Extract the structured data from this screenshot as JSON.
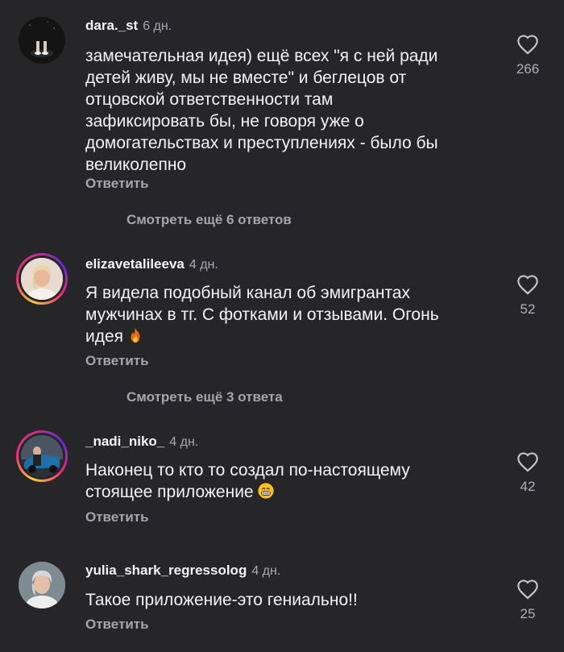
{
  "comments": [
    {
      "username": "dara._st",
      "time": "6 дн.",
      "text_lines": [
        "замечательная идея) ещё всех \"я с ней ради",
        "детей живу, мы не вместе\" и беглецов от",
        "отцовской ответственности там",
        "зафиксировать бы, не говоря уже о",
        "домогательствах и преступлениях - было бы",
        "великолепно"
      ],
      "reply_label": "Ответить",
      "likes": "266",
      "more_replies": "Смотреть ещё 6 ответов"
    },
    {
      "username": "elizavetalileeva",
      "time": "4 дн.",
      "text_lines": [
        "Я видела подобный канал об эмигрантах",
        "мужчинах в тг. С фотками и отзывами. Огонь",
        "идея"
      ],
      "emoji": "fire-emoji",
      "reply_label": "Ответить",
      "likes": "52",
      "more_replies": "Смотреть ещё 3 ответа"
    },
    {
      "username": "_nadi_niko_",
      "time": "4 дн.",
      "text_lines": [
        "Наконец то кто то создал по-настоящему",
        "стоящее приложение"
      ],
      "emoji": "grinning-face-emoji",
      "reply_label": "Ответить",
      "likes": "42"
    },
    {
      "username": "yulia_shark_regressolog",
      "time": "4 дн.",
      "text_lines": [
        "Такое приложение-это гениально!!"
      ],
      "reply_label": "Ответить",
      "likes": "25"
    }
  ],
  "colors": {
    "background": "#262628",
    "primary_text": "#f2f2f2",
    "secondary_text": "#a6a6aa",
    "story_ring": "#ee2a7b"
  }
}
